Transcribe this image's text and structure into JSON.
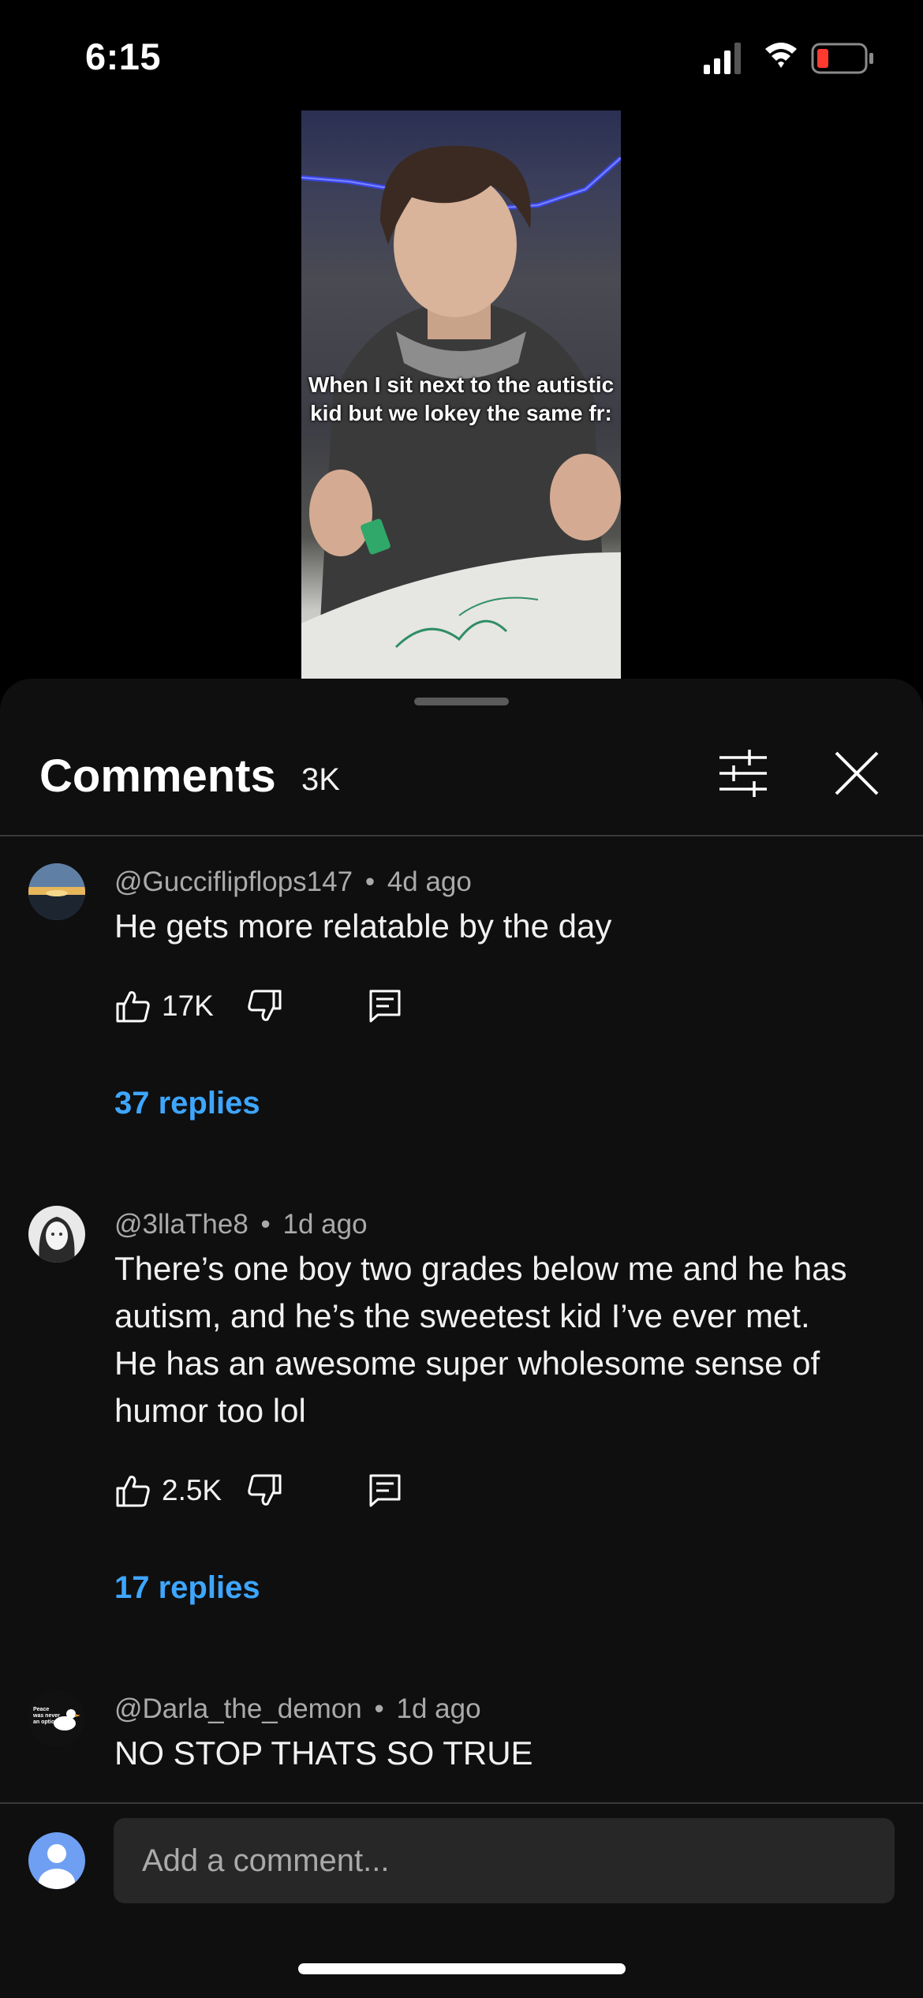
{
  "status_bar": {
    "time": "6:15",
    "icons": [
      "cellular-signal-icon",
      "wifi-icon",
      "battery-low-icon"
    ]
  },
  "video": {
    "caption": "When I sit next to the autistic kid but we lokey the same fr:"
  },
  "comments_panel": {
    "title": "Comments",
    "count": "3K",
    "filter_icon": "sliders-icon",
    "close_icon": "close-icon",
    "comments": [
      {
        "author": "@Gucciflipflops147",
        "age": "4d ago",
        "text": "He gets more relatable by the day",
        "likes": "17K",
        "replies": "37 replies"
      },
      {
        "author": "@3llaThe8",
        "age": "1d ago",
        "text": "There’s one boy two grades below me and he has autism, and he’s the sweetest kid I’ve ever met. He has an awesome super wholesome sense of humor too lol",
        "likes": "2.5K",
        "replies": "17 replies"
      },
      {
        "author": "@Darla_the_demon",
        "age": "1d ago",
        "text": "NO STOP THATS SO TRUE"
      }
    ],
    "avatar_3_text": "Peace was never an option",
    "separator": "•",
    "composer": {
      "placeholder": "Add a comment..."
    }
  },
  "colors": {
    "background": "#0f0f0f",
    "link": "#3ea6ff",
    "battery_low": "#ff3b30",
    "composer_avatar": "#6f9ff2"
  }
}
